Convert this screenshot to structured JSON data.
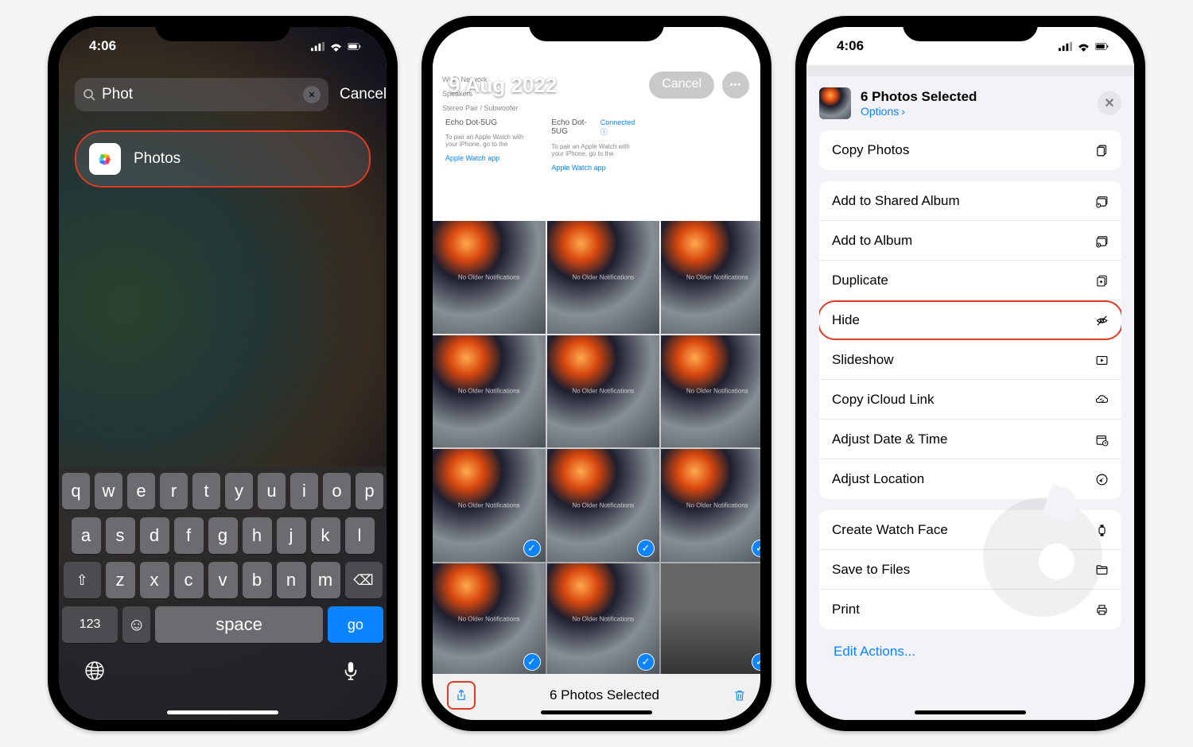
{
  "status": {
    "time": "4:06"
  },
  "screen1": {
    "search_value": "Phot",
    "cancel": "Cancel",
    "result_label": "Photos",
    "keys_r1": [
      "q",
      "w",
      "e",
      "r",
      "t",
      "y",
      "u",
      "i",
      "o",
      "p"
    ],
    "keys_r2": [
      "a",
      "s",
      "d",
      "f",
      "g",
      "h",
      "j",
      "k",
      "l"
    ],
    "keys_r3": [
      "z",
      "x",
      "c",
      "v",
      "b",
      "n",
      "m"
    ],
    "key_123": "123",
    "key_space": "space",
    "key_go": "go"
  },
  "screen2": {
    "date": "9 Aug 2022",
    "cancel": "Cancel",
    "settings_hint": {
      "wifi": "Wi-Fi Network",
      "speakers": "Speakers",
      "sub": "Stereo Pair / Subwoofer",
      "echo1": "Echo Dot-5UG",
      "echo2": "Echo Dot-5UG",
      "connected": "Connected",
      "pair": "To pair an Apple Watch with your iPhone, go to the",
      "awapp": "Apple Watch app"
    },
    "thumb_label": "No Older Notifications",
    "selected_count": "6 Photos Selected"
  },
  "screen3": {
    "header_title": "6 Photos Selected",
    "options": "Options",
    "actions": {
      "copy_photos": "Copy Photos",
      "add_shared": "Add to Shared Album",
      "add_album": "Add to Album",
      "duplicate": "Duplicate",
      "hide": "Hide",
      "slideshow": "Slideshow",
      "copy_icloud": "Copy iCloud Link",
      "adjust_date": "Adjust Date & Time",
      "adjust_location": "Adjust Location",
      "watch_face": "Create Watch Face",
      "save_files": "Save to Files",
      "print": "Print"
    },
    "edit_actions": "Edit Actions..."
  }
}
